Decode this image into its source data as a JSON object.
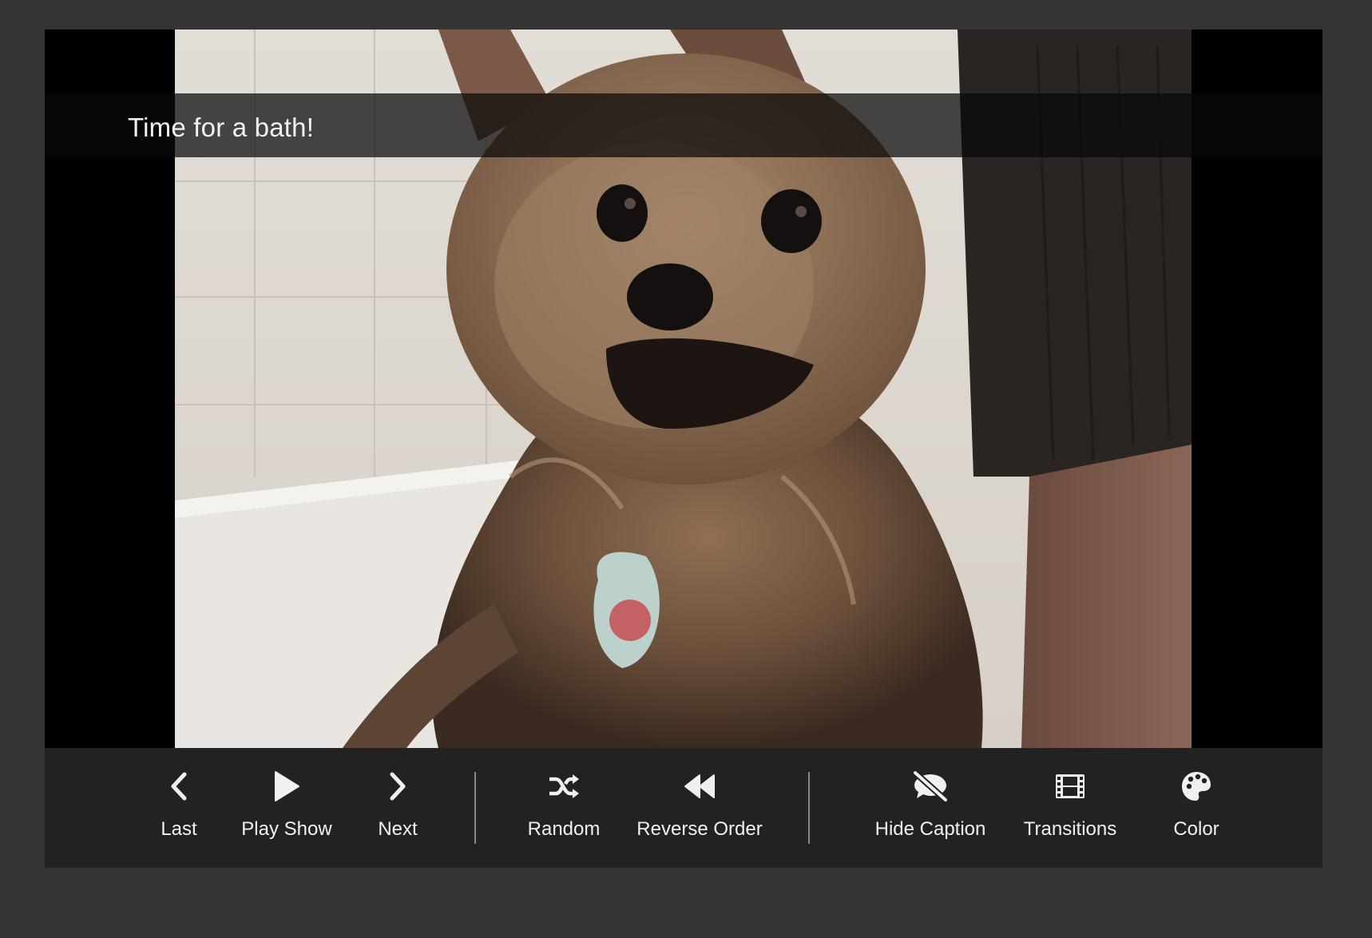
{
  "slide": {
    "caption": "Time for a bath!",
    "image_subject": "wet-pomeranian-dog-in-bathtub"
  },
  "controls": {
    "last": {
      "label": "Last",
      "icon": "chevron-left-icon"
    },
    "play": {
      "label": "Play Show",
      "icon": "play-icon"
    },
    "next": {
      "label": "Next",
      "icon": "chevron-right-icon"
    },
    "random": {
      "label": "Random",
      "icon": "shuffle-icon"
    },
    "reverse": {
      "label": "Reverse Order",
      "icon": "backward-icon"
    },
    "hide_caption": {
      "label": "Hide Caption",
      "icon": "comment-slash-icon"
    },
    "transitions": {
      "label": "Transitions",
      "icon": "film-icon"
    },
    "color": {
      "label": "Color",
      "icon": "palette-icon"
    }
  },
  "colors": {
    "page_background": "#343434",
    "toolbar_background": "#222222",
    "stage_background": "#000000",
    "text": "#f0f0f0"
  }
}
